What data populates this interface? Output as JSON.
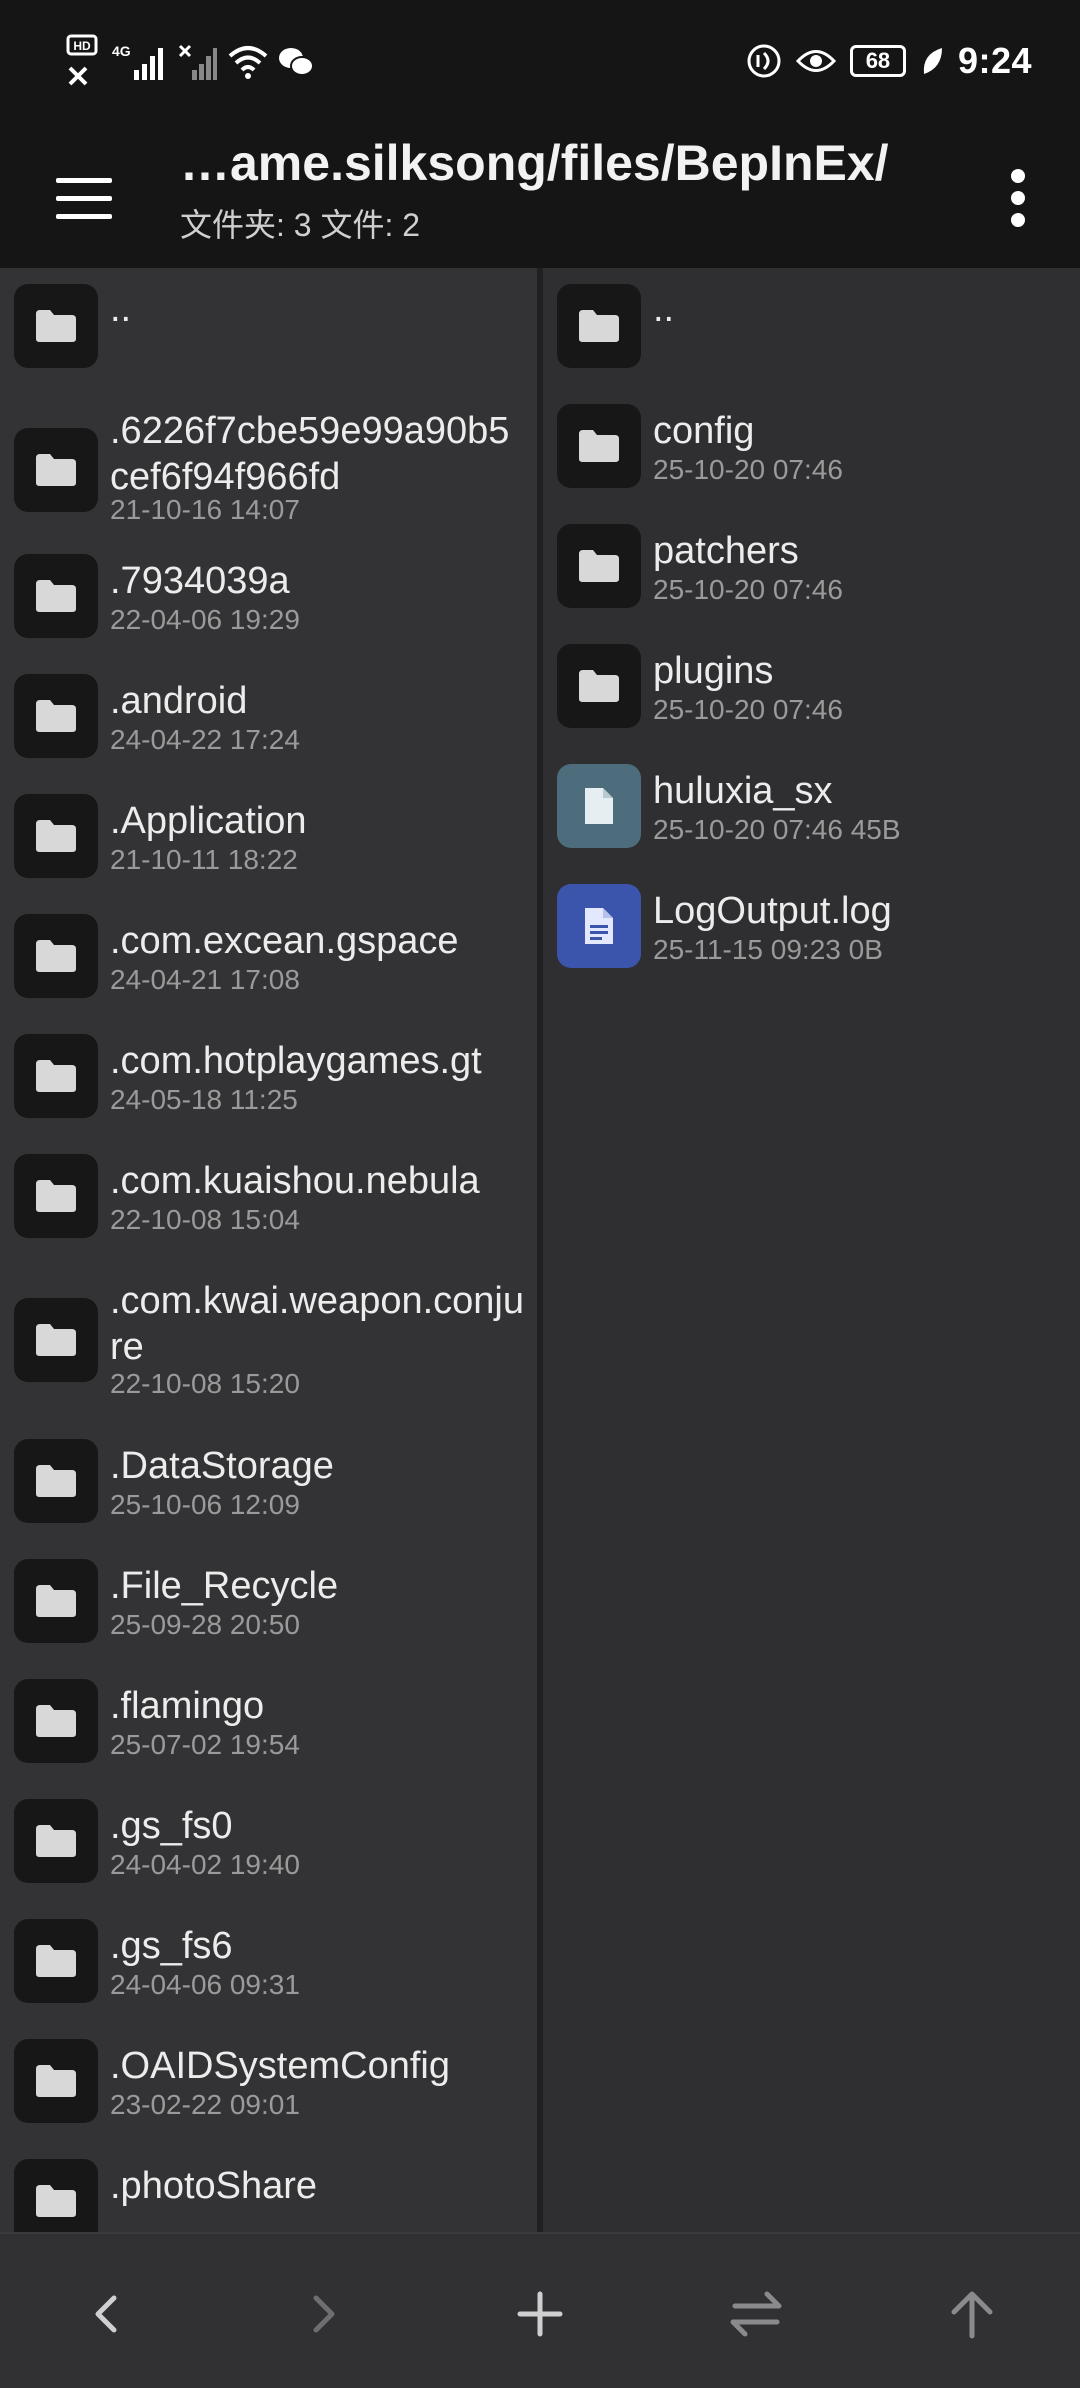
{
  "status_bar": {
    "time": "9:24",
    "battery": "68",
    "network": "4G",
    "hd_badge": "HD",
    "icons": [
      "hd-icon",
      "signal-icon",
      "no-sim-signal-icon",
      "wifi-icon",
      "wechat-icon",
      "nfc-icon",
      "eye-comfort-icon",
      "battery-icon",
      "charging-leaf-icon"
    ]
  },
  "appbar": {
    "title": "…ame.silksong/files/BepInEx/",
    "subtitle": "文件夹: 3  文件: 2"
  },
  "left_pane": {
    "items": [
      {
        "name": "..",
        "meta": "",
        "icon": "folder-icon"
      },
      {
        "name": ".6226f7cbe59e99a90b5cef6f94f966fd",
        "meta": "21-10-16 14:07",
        "icon": "folder-icon"
      },
      {
        "name": ".7934039a",
        "meta": "22-04-06 19:29",
        "icon": "folder-icon"
      },
      {
        "name": ".android",
        "meta": "24-04-22 17:24",
        "icon": "folder-icon"
      },
      {
        "name": ".Application",
        "meta": "21-10-11 18:22",
        "icon": "folder-icon"
      },
      {
        "name": ".com.excean.gspace",
        "meta": "24-04-21 17:08",
        "icon": "folder-icon"
      },
      {
        "name": ".com.hotplaygames.gt",
        "meta": "24-05-18 11:25",
        "icon": "folder-icon"
      },
      {
        "name": ".com.kuaishou.nebula",
        "meta": "22-10-08 15:04",
        "icon": "folder-icon"
      },
      {
        "name": ".com.kwai.weapon.conjure",
        "meta": "22-10-08 15:20",
        "icon": "folder-icon"
      },
      {
        "name": ".DataStorage",
        "meta": "25-10-06 12:09",
        "icon": "folder-icon"
      },
      {
        "name": ".File_Recycle",
        "meta": "25-09-28 20:50",
        "icon": "folder-icon"
      },
      {
        "name": ".flamingo",
        "meta": "25-07-02 19:54",
        "icon": "folder-icon"
      },
      {
        "name": ".gs_fs0",
        "meta": "24-04-02 19:40",
        "icon": "folder-icon"
      },
      {
        "name": ".gs_fs6",
        "meta": "24-04-06 09:31",
        "icon": "folder-icon"
      },
      {
        "name": ".OAIDSystemConfig",
        "meta": "23-02-22 09:01",
        "icon": "folder-icon"
      },
      {
        "name": ".photoShare",
        "meta": "",
        "icon": "folder-icon"
      }
    ]
  },
  "right_pane": {
    "items": [
      {
        "name": "..",
        "meta": "",
        "icon": "folder-icon"
      },
      {
        "name": "config",
        "meta": "25-10-20 07:46",
        "icon": "folder-icon"
      },
      {
        "name": "patchers",
        "meta": "25-10-20 07:46",
        "icon": "folder-icon"
      },
      {
        "name": "plugins",
        "meta": "25-10-20 07:46",
        "icon": "folder-icon"
      },
      {
        "name": "huluxia_sx",
        "meta": "25-10-20 07:46  45B",
        "icon": "file-icon"
      },
      {
        "name": "LogOutput.log",
        "meta": "25-11-15 09:23  0B",
        "icon": "text-file-icon"
      }
    ]
  },
  "toolbar": {
    "buttons": [
      "back-icon",
      "forward-icon",
      "add-icon",
      "swap-panes-icon",
      "up-directory-icon"
    ]
  },
  "colors": {
    "bar_background": "#151515",
    "left_pane": "#333335",
    "right_pane": "#2f2f31",
    "file_icon_gray": "#4d6c7c",
    "file_icon_blue": "#3b55ad"
  }
}
